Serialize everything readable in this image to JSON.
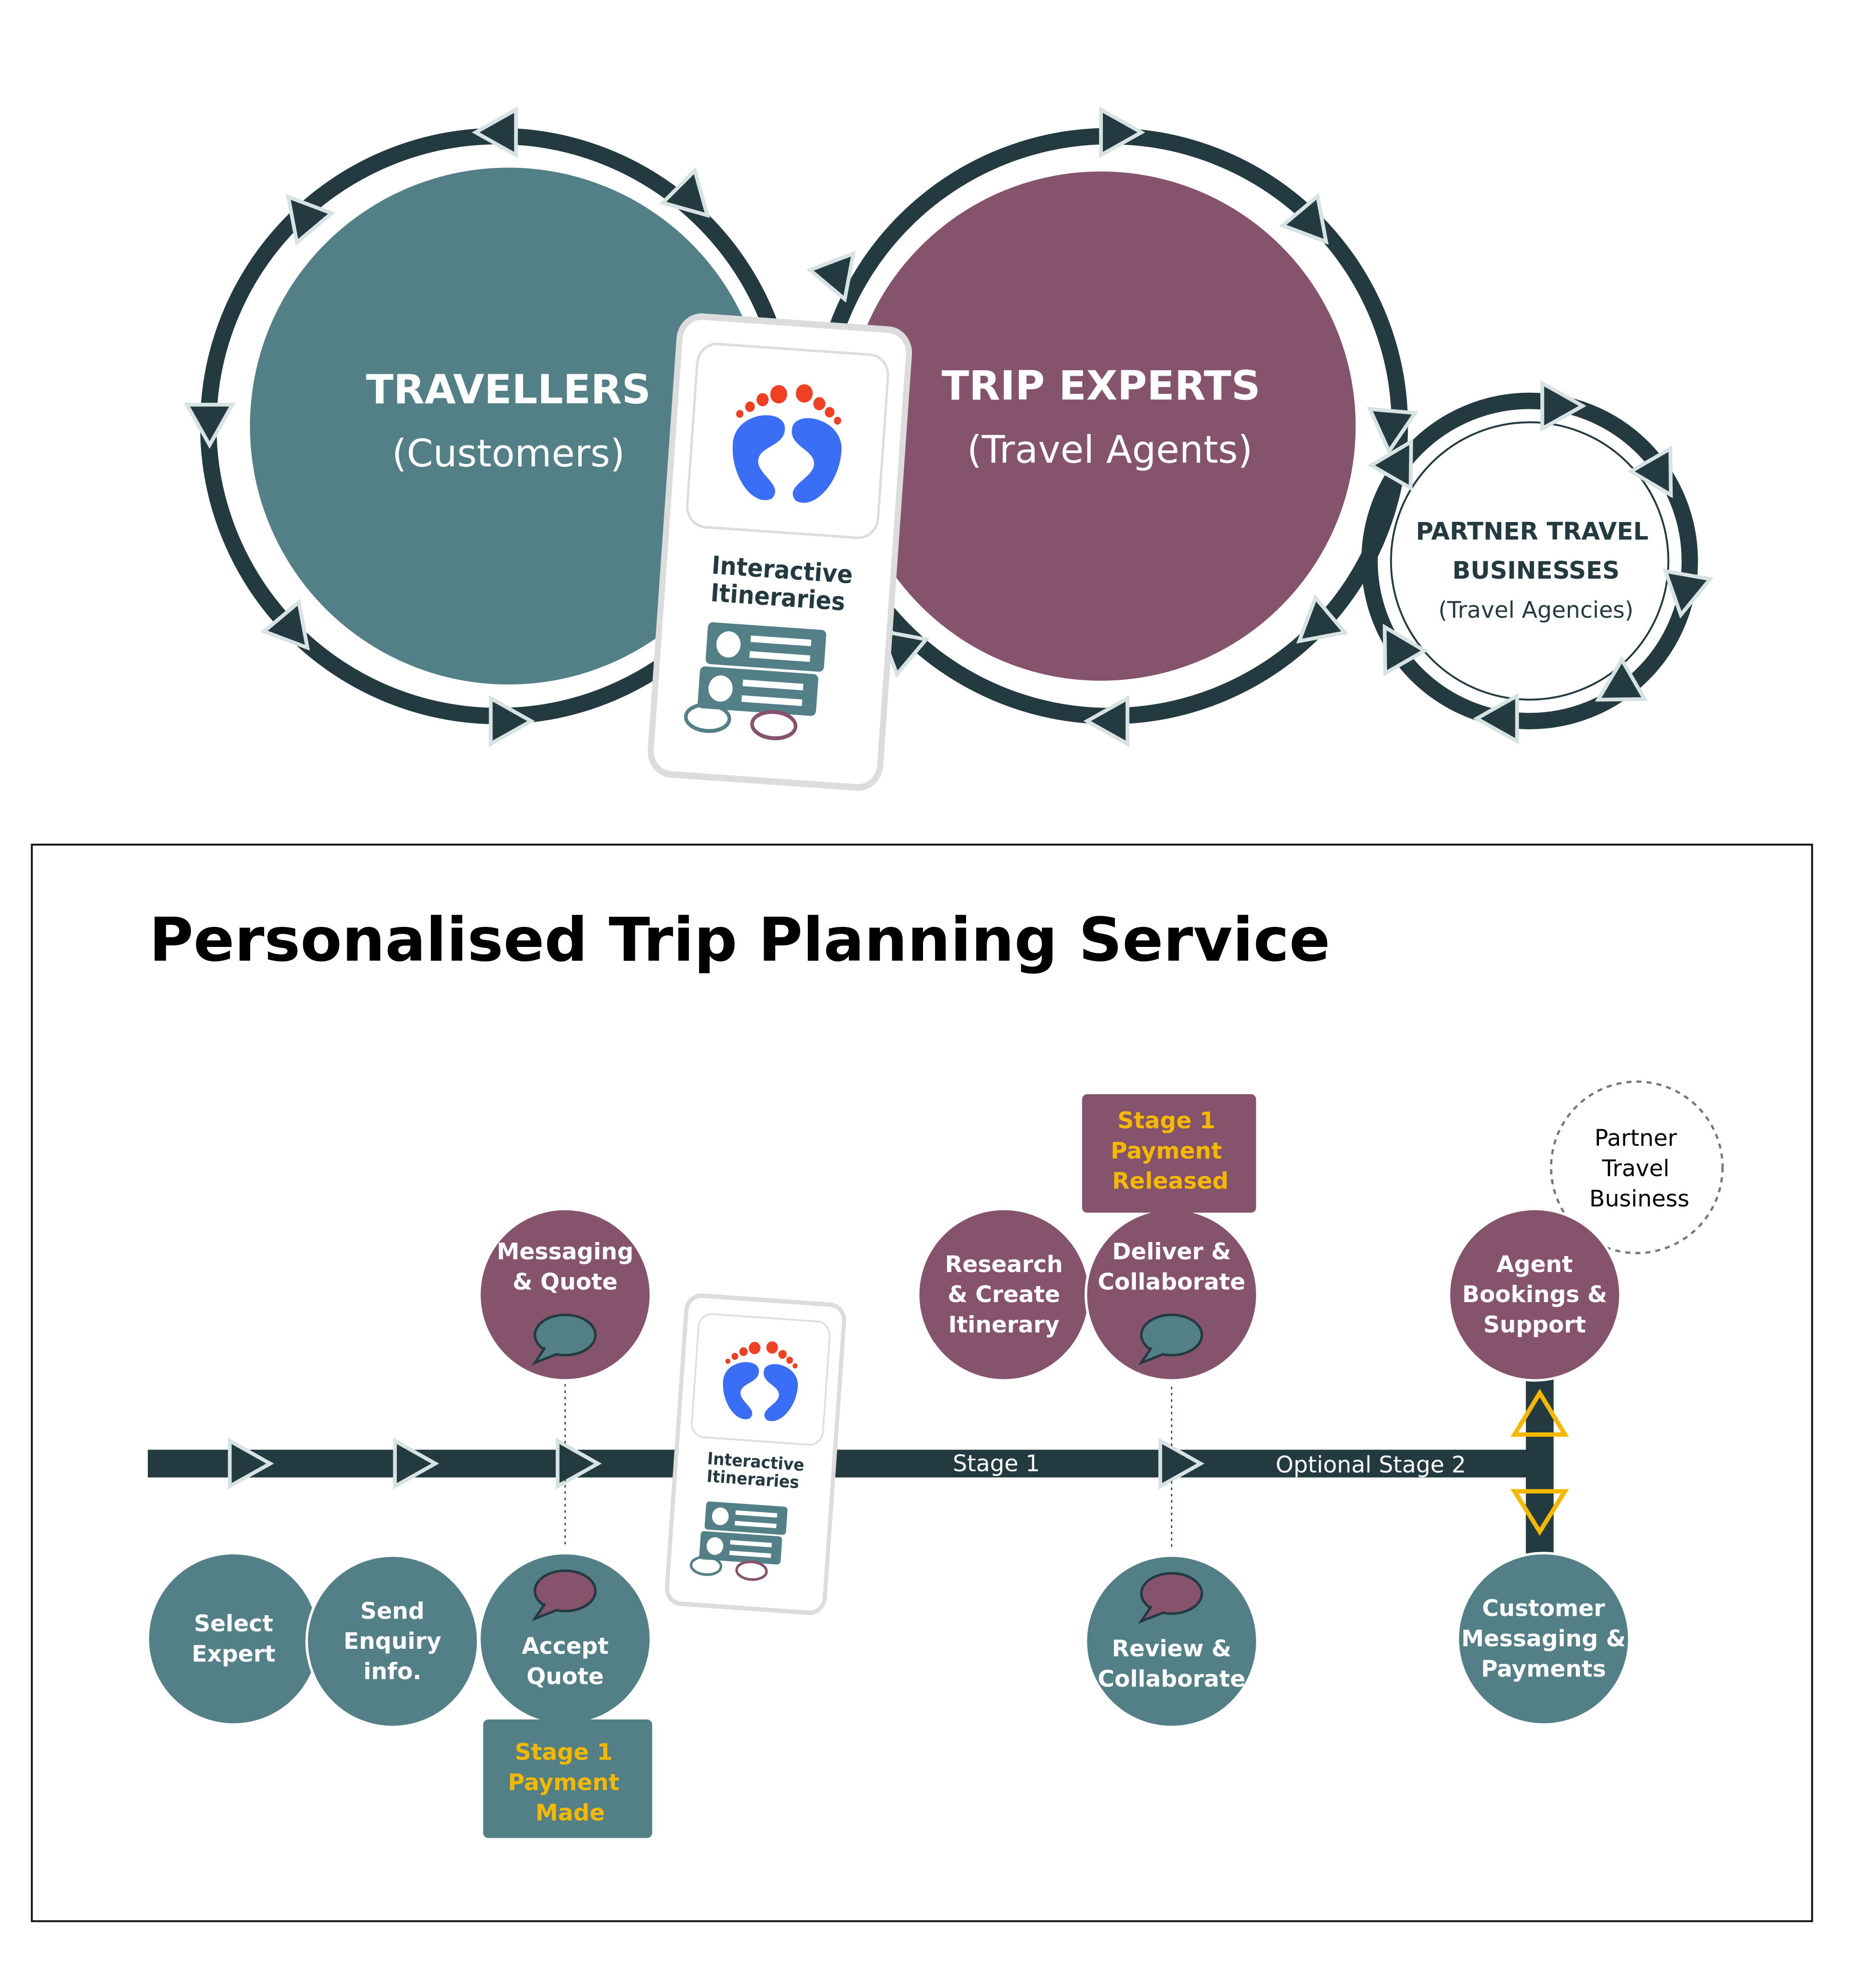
{
  "colors": {
    "teal": "#537f87",
    "plum": "#86536d",
    "dark": "#223a40",
    "yellow": "#f5b800",
    "footprint_blue": "#3a6ff5",
    "footprint_red": "#f04023"
  },
  "ecosystem": {
    "travellers": {
      "title": "TRAVELLERS",
      "subtitle": "(Customers)"
    },
    "experts": {
      "title": "TRIP EXPERTS",
      "subtitle": "(Travel Agents)"
    },
    "partners": {
      "title_line1": "PARTNER TRAVEL",
      "title_line2": "BUSINESSES",
      "subtitle": "(Travel Agencies)"
    },
    "app": {
      "line1": "Interactive",
      "line2": "Itineraries",
      "logo_icon": "footprints-icon"
    }
  },
  "service": {
    "title": "Personalised Trip Planning Service",
    "stage1_label": "Stage 1",
    "stage2_label": "Optional Stage 2",
    "nodes": [
      {
        "id": "select-expert",
        "lines": [
          "Select",
          "Expert"
        ],
        "color": "teal"
      },
      {
        "id": "send-enquiry",
        "lines": [
          "Send",
          "Enquiry",
          "info."
        ],
        "color": "teal"
      },
      {
        "id": "accept-quote",
        "lines": [
          "Accept",
          "Quote"
        ],
        "color": "teal",
        "icon": "chat-bubble-icon"
      },
      {
        "id": "messaging-quote",
        "lines": [
          "Messaging",
          "& Quote"
        ],
        "color": "plum",
        "icon": "chat-bubble-icon"
      },
      {
        "id": "research-create",
        "lines": [
          "Research",
          "& Create",
          "Itinerary"
        ],
        "color": "plum"
      },
      {
        "id": "deliver-collaborate",
        "lines": [
          "Deliver &",
          "Collaborate"
        ],
        "color": "plum",
        "icon": "chat-bubble-icon"
      },
      {
        "id": "review-collaborate",
        "lines": [
          "Review &",
          "Collaborate"
        ],
        "color": "teal",
        "icon": "chat-bubble-icon"
      },
      {
        "id": "agent-bookings",
        "lines": [
          "Agent",
          "Bookings &",
          "Support"
        ],
        "color": "plum"
      },
      {
        "id": "customer-messaging",
        "lines": [
          "Customer",
          "Messaging &",
          "Payments"
        ],
        "color": "teal"
      }
    ],
    "payment_released": [
      "Stage 1",
      "Payment",
      "Released"
    ],
    "payment_made": [
      "Stage 1",
      "Payment",
      "Made"
    ],
    "partner_bubble": [
      "Partner",
      "Travel",
      "Business"
    ]
  }
}
